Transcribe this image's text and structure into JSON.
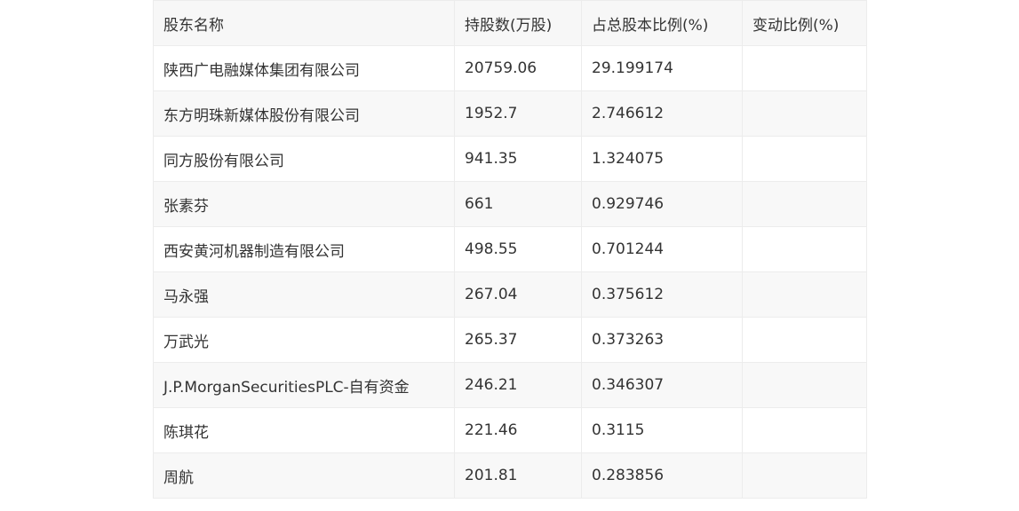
{
  "table": {
    "headers": [
      "股东名称",
      "持股数(万股)",
      "占总股本比例(%)",
      "变动比例(%)"
    ],
    "rows": [
      [
        "陕西广电融媒体集团有限公司",
        "20759.06",
        "29.199174",
        ""
      ],
      [
        "东方明珠新媒体股份有限公司",
        "1952.7",
        "2.746612",
        ""
      ],
      [
        "同方股份有限公司",
        "941.35",
        "1.324075",
        ""
      ],
      [
        "张素芬",
        "661",
        "0.929746",
        ""
      ],
      [
        "西安黄河机器制造有限公司",
        "498.55",
        "0.701244",
        ""
      ],
      [
        "马永强",
        "267.04",
        "0.375612",
        ""
      ],
      [
        "万武光",
        "265.37",
        "0.373263",
        ""
      ],
      [
        "J.P.MorganSecuritiesPLC-自有资金",
        "246.21",
        "0.346307",
        ""
      ],
      [
        "陈琪花",
        "221.46",
        "0.3115",
        ""
      ],
      [
        "周航",
        "201.81",
        "0.283856",
        ""
      ]
    ]
  }
}
